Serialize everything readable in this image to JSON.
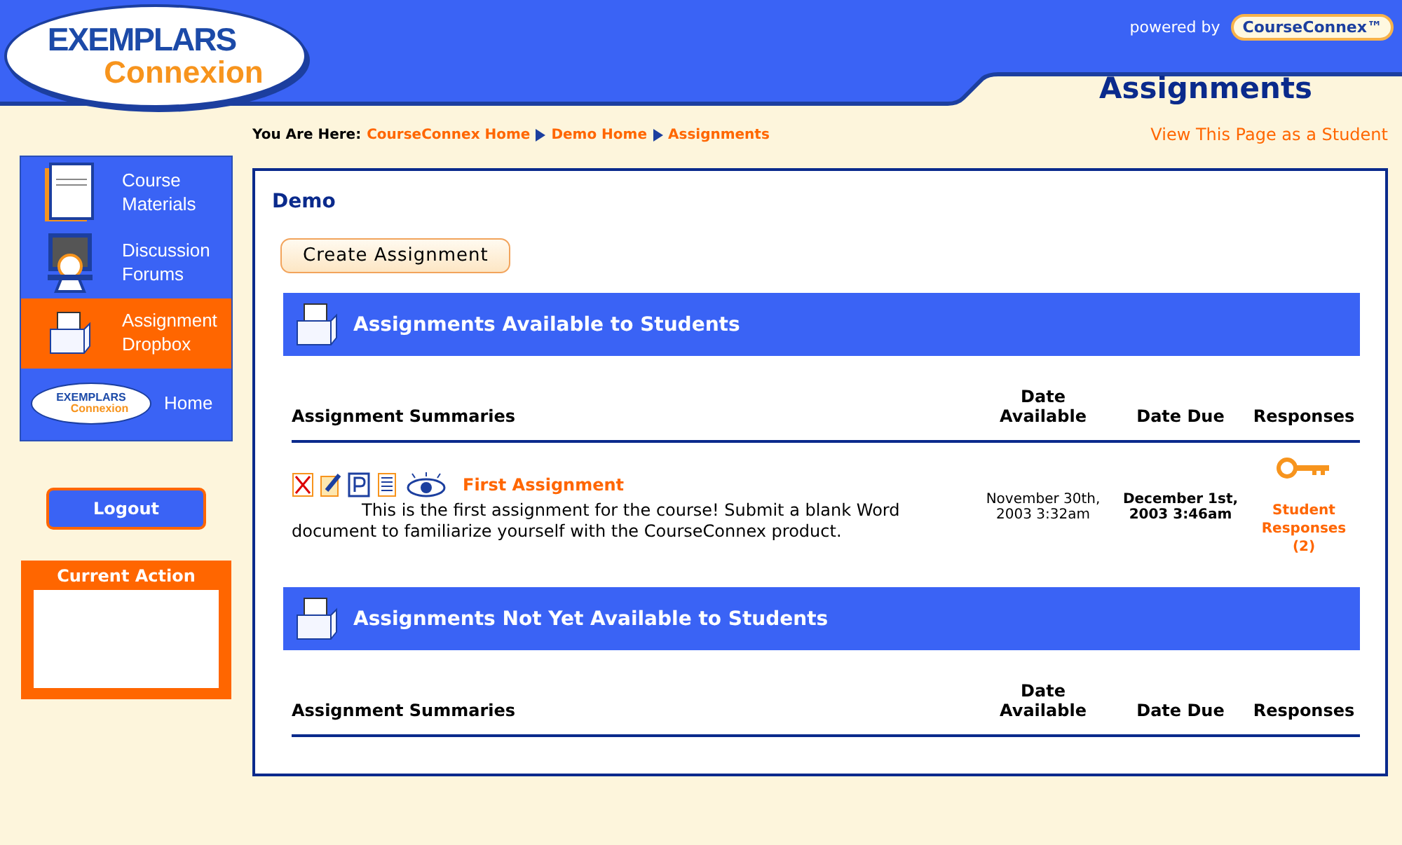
{
  "header": {
    "logo_top": "EXEMPLARS",
    "logo_bottom": "Connexion",
    "powered_by": "powered by",
    "badge": "CourseConnex™",
    "page_title": "Assignments"
  },
  "breadcrumb": {
    "label": "You Are Here:",
    "links": [
      "CourseConnex Home",
      "Demo Home",
      "Assignments"
    ]
  },
  "student_view_link": "View This Page as a Student",
  "sidebar": {
    "items": [
      {
        "kind": "materials",
        "label": "Course Materials",
        "selected": false
      },
      {
        "kind": "forums",
        "label": "Discussion Forums",
        "selected": false
      },
      {
        "kind": "dropbox",
        "label": "Assignment Dropbox",
        "selected": true
      },
      {
        "kind": "home",
        "label": "Home",
        "selected": false,
        "logo_top": "EXEMPLARS",
        "logo_bottom": "Connexion"
      }
    ],
    "logout": "Logout",
    "current_action": {
      "title": "Current Action"
    }
  },
  "main": {
    "course": "Demo",
    "create_button": "Create Assignment",
    "sections": [
      {
        "title": "Assignments Available to Students",
        "columns": [
          "Assignment Summaries",
          "Date Available",
          "Date Due",
          "Responses"
        ],
        "rows": [
          {
            "title": "First Assignment",
            "description": "This is the first assignment for the course! Submit a blank Word document to familiarize yourself with the CourseConnex product.",
            "date_available": "November 30th, 2003 3:32am",
            "date_due": "December 1st, 2003 3:46am",
            "responses": "Student Responses (2)"
          }
        ]
      },
      {
        "title": "Assignments Not Yet Available to Students",
        "columns": [
          "Assignment Summaries",
          "Date Available",
          "Date Due",
          "Responses"
        ]
      }
    ]
  }
}
